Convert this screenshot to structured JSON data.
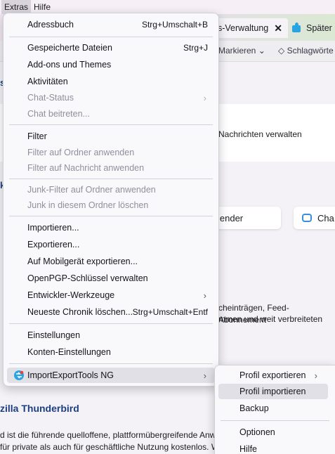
{
  "menubar": [
    "Extras",
    "Hilfe"
  ],
  "tabs": [
    {
      "label": "s-Verwaltung"
    },
    {
      "label": "Später"
    }
  ],
  "toolbar": {
    "mark": "Markieren",
    "tags": "Schlagwörte"
  },
  "background": {
    "manage_text": "Nachrichten verwalten",
    "calendar_btn": "lender",
    "chat_btn": "Cha",
    "para1_line1": "cheinträgen, Feed-Abonnement",
    "para1_line2": "mmen und weit verbreiteten",
    "about_heading": "zilla Thunderbird",
    "about_line1": "d ist die führende quelloffene, plattformübergreifende Anw",
    "about_line2": " für private als auch für geschäftliche Nutzung kostenlos. W"
  },
  "menu": {
    "items": [
      {
        "label": "Adressbuch",
        "shortcut": "Strg+Umschalt+B",
        "disabled": false
      },
      {
        "label": "Gespeicherte Dateien",
        "shortcut": "Strg+J",
        "disabled": false
      },
      {
        "label": "Add-ons und Themes",
        "disabled": false
      },
      {
        "label": "Aktivitäten",
        "disabled": false
      },
      {
        "label": "Chat-Status",
        "disabled": true,
        "submenu": true
      },
      {
        "label": "Chat beitreten...",
        "disabled": true
      },
      {
        "label": "Filter",
        "disabled": false
      },
      {
        "label": "Filter auf Ordner anwenden",
        "disabled": true
      },
      {
        "label": "Filter auf Nachricht anwenden",
        "disabled": true
      },
      {
        "label": "Junk-Filter auf Ordner anwenden",
        "disabled": true
      },
      {
        "label": "Junk in diesem Ordner löschen",
        "disabled": true
      },
      {
        "label": "Importieren...",
        "disabled": false
      },
      {
        "label": "Exportieren...",
        "disabled": false
      },
      {
        "label": "Auf Mobilgerät exportieren...",
        "disabled": false
      },
      {
        "label": "OpenPGP-Schlüssel verwalten",
        "disabled": false
      },
      {
        "label": "Entwickler-Werkzeuge",
        "disabled": false,
        "submenu": true
      },
      {
        "label": "Neueste Chronik löschen...",
        "shortcut": "Strg+Umschalt+Entf",
        "disabled": false
      },
      {
        "label": "Einstellungen",
        "disabled": false
      },
      {
        "label": "Konten-Einstellungen",
        "disabled": false
      },
      {
        "label": "ImportExportTools NG",
        "disabled": false,
        "submenu": true,
        "icon": "importexport-icon"
      }
    ]
  },
  "submenu": {
    "items": [
      {
        "label": "Profil exportieren",
        "submenu": true
      },
      {
        "label": "Profil importieren"
      },
      {
        "label": "Backup"
      },
      {
        "label": "Optionen"
      },
      {
        "label": "Hilfe"
      }
    ]
  },
  "colors": {
    "accent": "#1c3f82",
    "icon_blue": "#2aa4e0"
  }
}
